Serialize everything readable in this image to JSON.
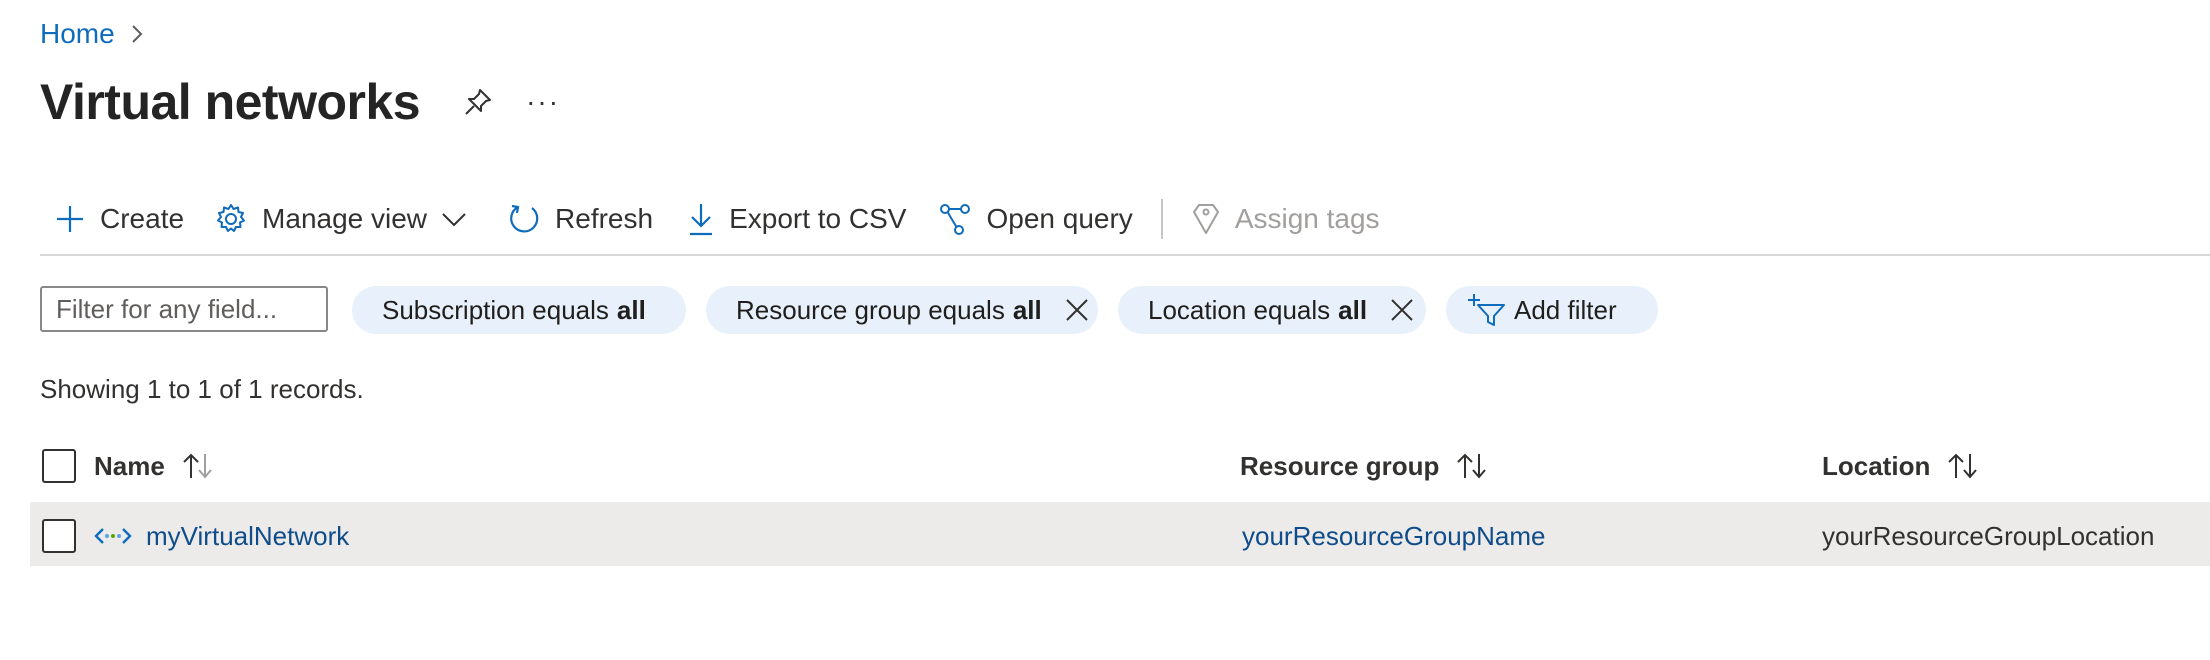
{
  "breadcrumb": {
    "home_label": "Home"
  },
  "page": {
    "title": "Virtual networks",
    "more_label": "···"
  },
  "toolbar": {
    "create_label": "Create",
    "manage_view_label": "Manage view",
    "refresh_label": "Refresh",
    "export_label": "Export to CSV",
    "open_query_label": "Open query",
    "assign_tags_label": "Assign tags"
  },
  "filters": {
    "search_placeholder": "Filter for any field...",
    "pills": [
      {
        "prefix": "Subscription equals",
        "value": "all"
      },
      {
        "prefix": "Resource group equals",
        "value": "all"
      },
      {
        "prefix": "Location equals",
        "value": "all"
      }
    ],
    "add_filter_label": "Add filter"
  },
  "records_text": "Showing 1 to 1 of 1 records.",
  "table": {
    "columns": [
      "Name",
      "Resource group",
      "Location"
    ],
    "rows": [
      {
        "name": "myVirtualNetwork",
        "resource_group": "yourResourceGroupName",
        "location": "yourResourceGroupLocation"
      }
    ]
  },
  "colors": {
    "accent": "#0f6cbd",
    "pill_bg": "#e8f1fb",
    "row_selected_bg": "#edebe9"
  },
  "icons": [
    "chevron-right-icon",
    "pin-icon",
    "plus-icon",
    "gear-icon",
    "chevron-down-icon",
    "refresh-icon",
    "download-icon",
    "query-icon",
    "tag-icon",
    "close-icon",
    "add-filter-icon",
    "sort-icon",
    "virtual-network-icon"
  ]
}
